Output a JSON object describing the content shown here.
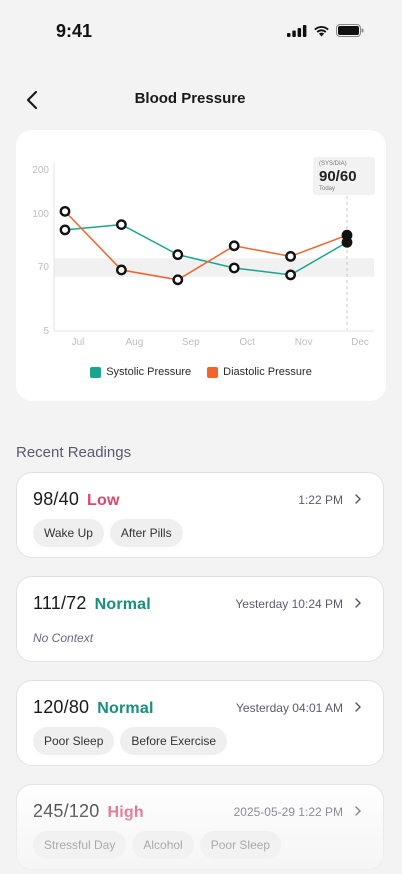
{
  "status_bar": {
    "time": "9:41"
  },
  "header": {
    "title": "Blood Pressure"
  },
  "chart_data": {
    "type": "line",
    "categories": [
      "Jul",
      "Aug",
      "Sep",
      "Oct",
      "Nov",
      "Dec"
    ],
    "y_ticks": [
      "200",
      "100",
      "70",
      "5"
    ],
    "series": [
      {
        "name": "Systolic Pressure",
        "color": "#17a58f",
        "values": [
          91,
          94,
          77,
          69,
          62,
          84
        ]
      },
      {
        "name": "Diastolic Pressure",
        "color": "#f2642c",
        "values": [
          106,
          67,
          57,
          82,
          76,
          88
        ]
      }
    ],
    "normal_band": [
      60,
      75
    ],
    "tooltip": {
      "label": "(SYS/DIA)",
      "value": "90/60",
      "sub": "Today"
    }
  },
  "recent": {
    "title": "Recent Readings",
    "readings": [
      {
        "value": "98/40",
        "status": "Low",
        "status_color": "#e0466b",
        "time": "1:22 PM",
        "tags": [
          "Wake Up",
          "After Pills"
        ],
        "context": ""
      },
      {
        "value": "111/72",
        "status": "Normal",
        "status_color": "#14907c",
        "time": "Yesterday 10:24 PM",
        "tags": [],
        "context": "No Context"
      },
      {
        "value": "120/80",
        "status": "Normal",
        "status_color": "#14907c",
        "time": "Yesterday 04:01 AM",
        "tags": [
          "Poor Sleep",
          "Before Exercise"
        ],
        "context": ""
      },
      {
        "value": "245/120",
        "status": "High",
        "status_color": "#e0466b",
        "time": "2025-05-29 1:22 PM",
        "tags": [
          "Stressful Day",
          "Alcohol",
          "Poor Sleep"
        ],
        "context": ""
      }
    ]
  }
}
